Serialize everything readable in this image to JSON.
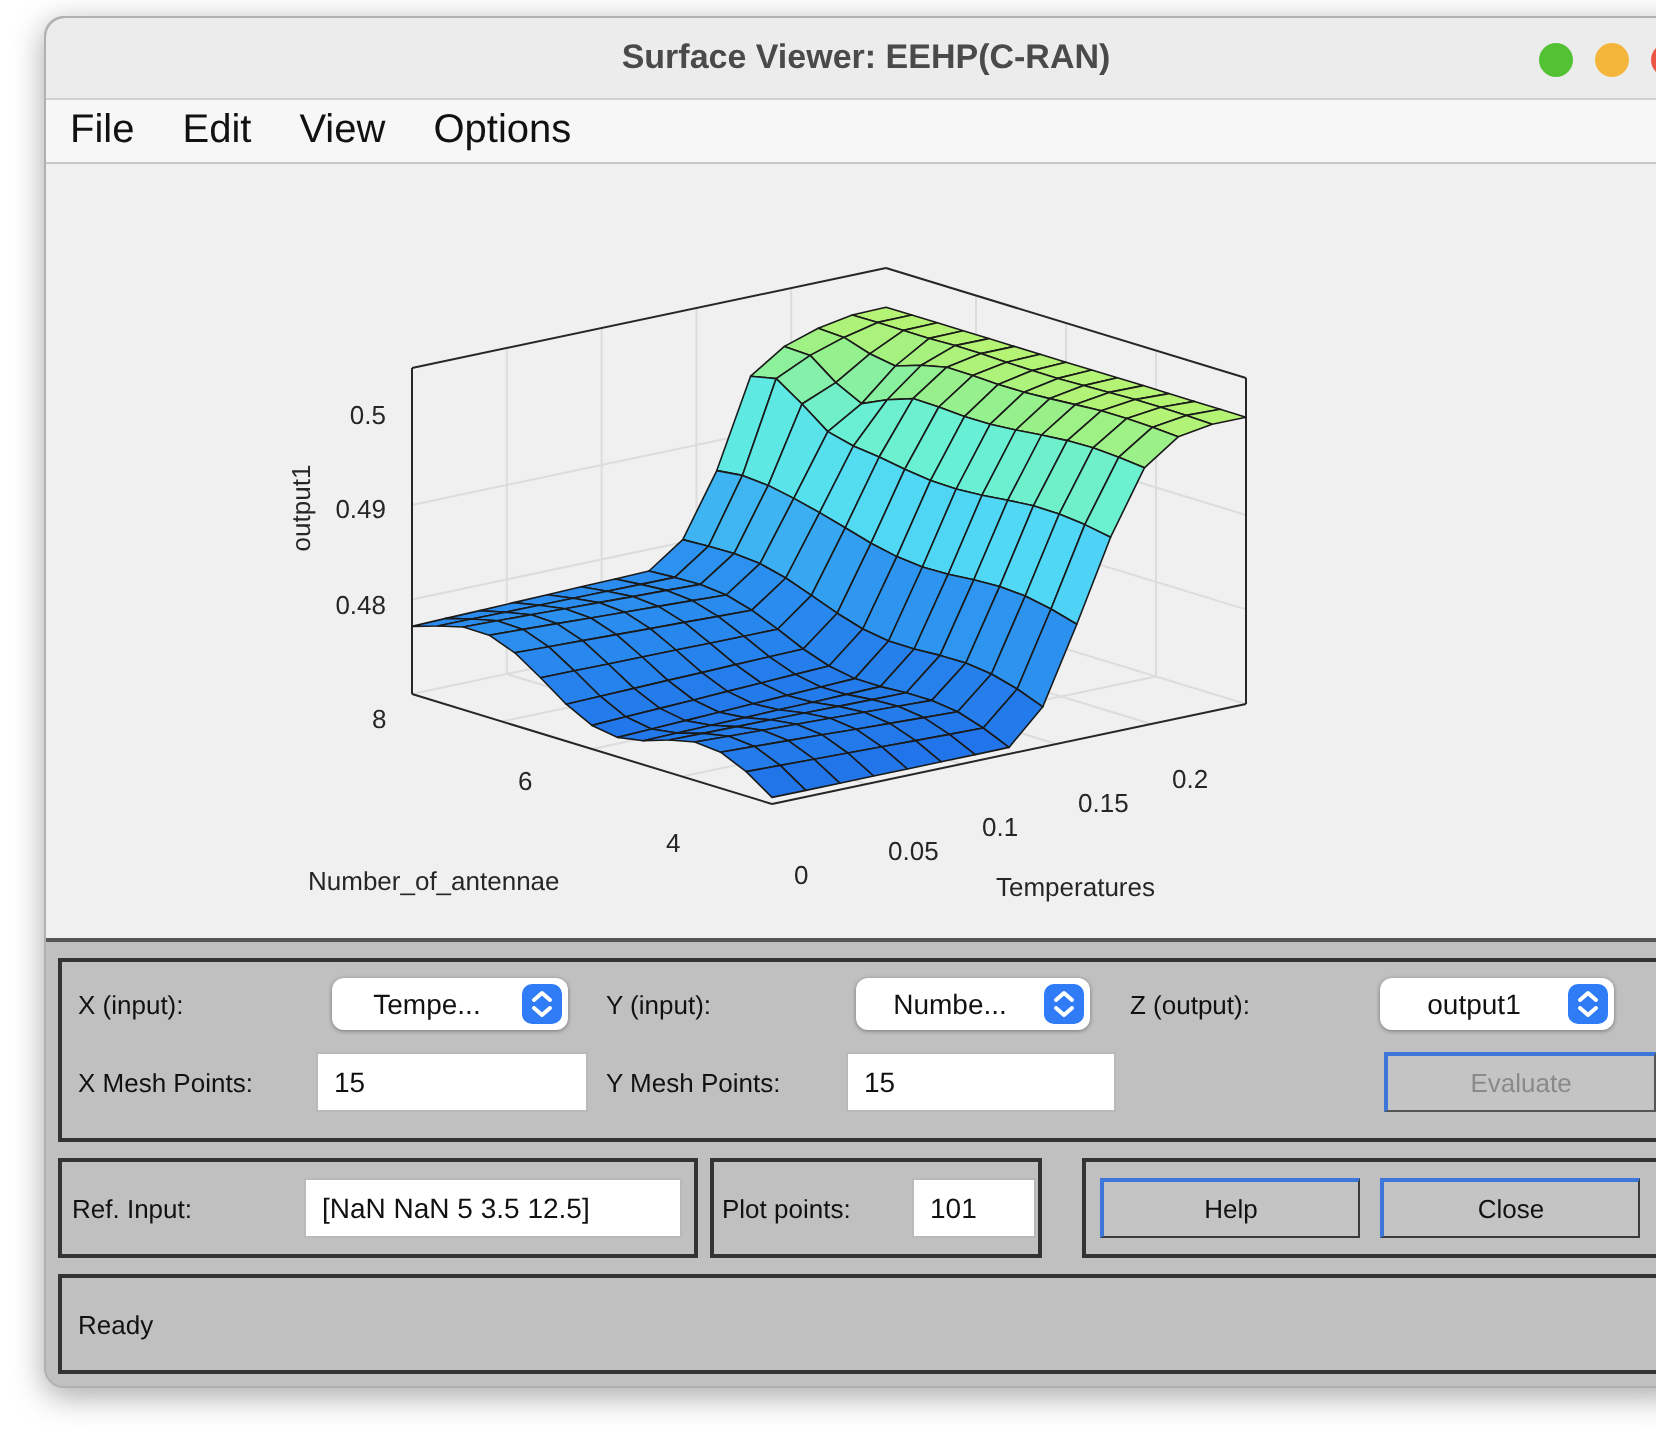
{
  "window": {
    "title": "Surface Viewer: EEHP(C-RAN)"
  },
  "menu": [
    "File",
    "Edit",
    "View",
    "Options"
  ],
  "plot": {
    "zlabel": "output1",
    "ylabel": "Number_of_antennae",
    "xlabel": "Temperatures",
    "z_ticks": [
      "0.5",
      "0.49",
      "0.48"
    ],
    "y_ticks": [
      "8",
      "6",
      "4"
    ],
    "x_ticks": [
      "0",
      "0.05",
      "0.1",
      "0.15",
      "0.2"
    ]
  },
  "selectors": [
    {
      "label": "X (input):",
      "value": "Tempe..."
    },
    {
      "label": "Y (input):",
      "value": "Numbe..."
    },
    {
      "label": "Z (output):",
      "value": "output1"
    }
  ],
  "mesh": [
    {
      "label": "X Mesh Points:",
      "value": "15"
    },
    {
      "label": "Y Mesh Points:",
      "value": "15"
    }
  ],
  "evaluate": {
    "label": "Evaluate",
    "disabled": true
  },
  "ref_input": {
    "label": "Ref. Input:",
    "value": "[NaN NaN 5 3.5 12.5]"
  },
  "plot_points": {
    "label": "Plot points:",
    "value": "101"
  },
  "buttons": [
    {
      "label": "Help"
    },
    {
      "label": "Close"
    }
  ],
  "status_bar": "Ready"
}
